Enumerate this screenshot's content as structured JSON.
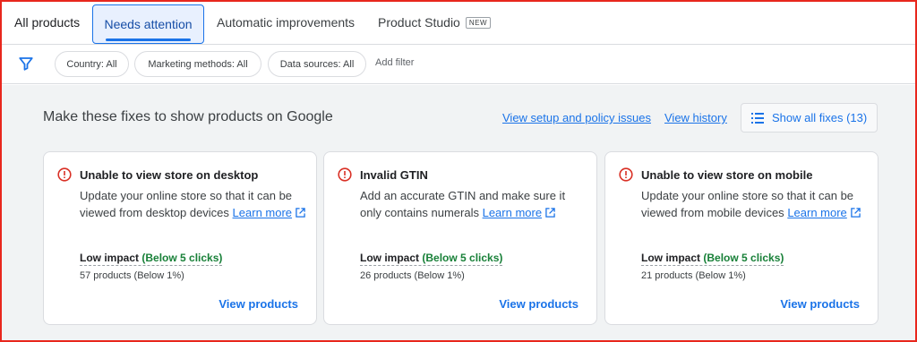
{
  "tabs": {
    "all_products": "All products",
    "needs_attention": "Needs attention",
    "automatic_improvements": "Automatic improvements",
    "product_studio": "Product Studio",
    "product_studio_badge": "NEW"
  },
  "filters": {
    "icon": "filter-icon",
    "country": "Country: All",
    "marketing": "Marketing methods: All",
    "sources": "Data sources: All",
    "add": "Add filter"
  },
  "main": {
    "heading": "Make these fixes to show products on Google",
    "link_setup": "View setup and policy issues",
    "link_history": "View history",
    "show_all": "Show all fixes (13)"
  },
  "cards": [
    {
      "title": "Unable to view store on desktop",
      "desc": "Update your online store so that it can be viewed from desktop devices",
      "learn": "Learn more",
      "impact": "Low impact",
      "impact_detail": "(Below 5 clicks)",
      "count": "57 products (Below 1%)",
      "action": "View products"
    },
    {
      "title": "Invalid GTIN",
      "desc": "Add an accurate GTIN and make sure it only contains numerals",
      "learn": "Learn more",
      "impact": "Low impact",
      "impact_detail": "(Below 5 clicks)",
      "count": "26 products (Below 1%)",
      "action": "View products"
    },
    {
      "title": "Unable to view store on mobile",
      "desc": "Update your online store so that it can be viewed from mobile devices",
      "learn": "Learn more",
      "impact": "Low impact",
      "impact_detail": "(Below 5 clicks)",
      "count": "21 products (Below 1%)",
      "action": "View products"
    }
  ],
  "colors": {
    "accent": "#1a73e8",
    "error": "#d93025",
    "impact_green": "#188038",
    "frame": "#e8271d"
  }
}
